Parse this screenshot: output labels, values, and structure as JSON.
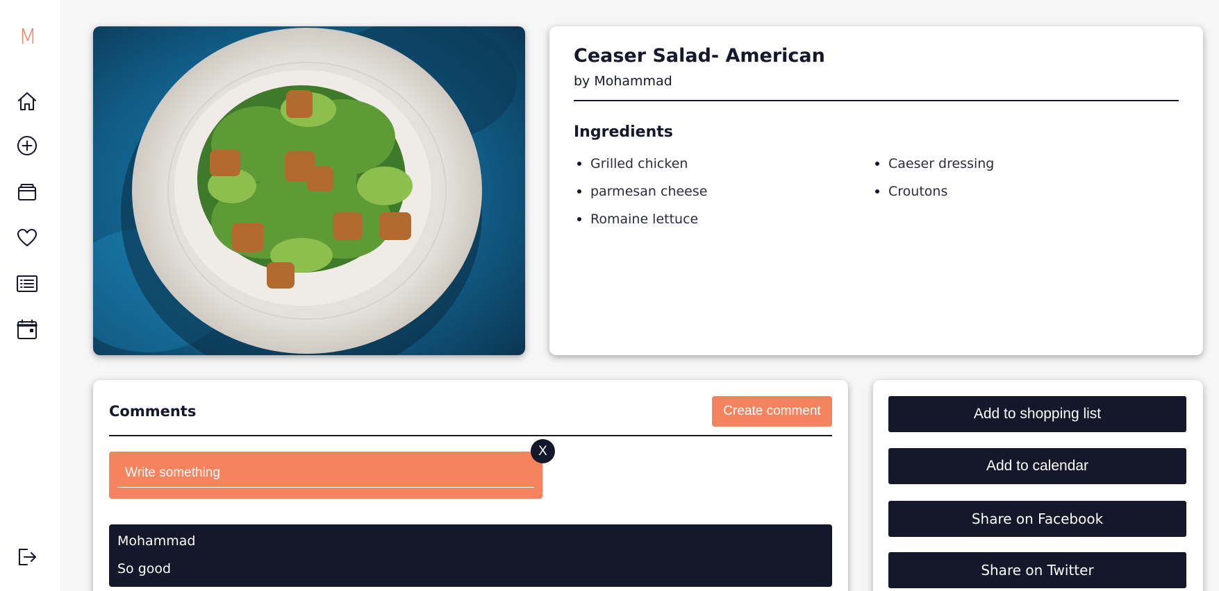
{
  "sidebar": {
    "logo": "M",
    "items": [
      {
        "name": "home",
        "icon": "home-icon"
      },
      {
        "name": "add",
        "icon": "plus-circle-icon"
      },
      {
        "name": "wallet",
        "icon": "wallet-icon"
      },
      {
        "name": "favorites",
        "icon": "heart-icon"
      },
      {
        "name": "list",
        "icon": "list-icon"
      },
      {
        "name": "calendar",
        "icon": "calendar-icon"
      }
    ],
    "logout_icon": "logout-icon"
  },
  "recipe": {
    "title": "Ceaser Salad- American",
    "author": "by Mohammad",
    "ingredients_heading": "Ingredients",
    "ingredients_left": [
      "Grilled chicken",
      "parmesan cheese",
      "Romaine lettuce"
    ],
    "ingredients_right": [
      "Caeser dressing",
      "Croutons"
    ]
  },
  "comments": {
    "title": "Comments",
    "create_label": "Create comment",
    "input_placeholder": "Write something",
    "close_label": "X",
    "items": [
      {
        "author": "Mohammad",
        "text": "So good"
      }
    ]
  },
  "actions": {
    "shopping_list": "Add to shopping list",
    "calendar": "Add to calendar",
    "facebook": "Share on Facebook",
    "twitter": "Share on Twitter"
  },
  "colors": {
    "accent": "#f5845e",
    "dark": "#15172a",
    "background": "#f6f6f6"
  }
}
